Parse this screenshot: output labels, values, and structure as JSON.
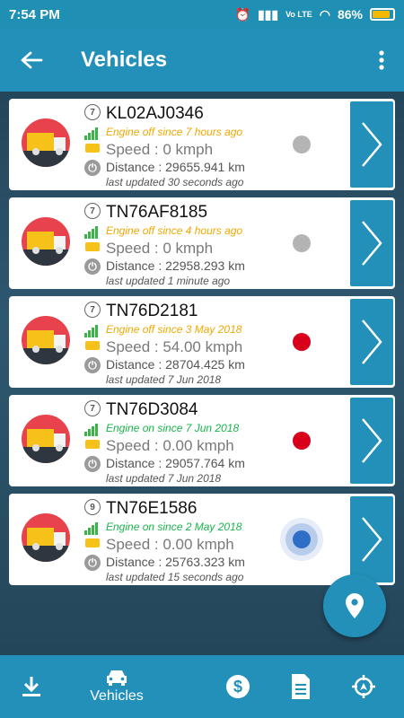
{
  "status_bar": {
    "time": "7:54 PM",
    "battery": "86%",
    "network": "Vo LTE"
  },
  "app_bar": {
    "title": "Vehicles"
  },
  "vehicles": [
    {
      "plate": "KL02AJ0346",
      "clock_badge": "7",
      "status": "Engine off since 7 hours ago",
      "speed": "Speed : 0 kmph",
      "distance": "Distance : 29655.941 km",
      "updated": "last updated 30 seconds ago"
    },
    {
      "plate": "TN76AF8185",
      "clock_badge": "7",
      "status": "Engine off since 4 hours ago",
      "speed": "Speed : 0 kmph",
      "distance": "Distance : 22958.293 km",
      "updated": "last updated 1 minute ago"
    },
    {
      "plate": "TN76D2181",
      "clock_badge": "7",
      "status": "Engine off since 3 May 2018",
      "speed": "Speed : 54.00 kmph",
      "distance": "Distance : 28704.425 km",
      "updated": "last updated 7 Jun 2018"
    },
    {
      "plate": "TN76D3084",
      "clock_badge": "7",
      "status": "Engine on since 7 Jun 2018",
      "speed": "Speed : 0.00 kmph",
      "distance": "Distance : 29057.764 km",
      "updated": "last updated 7 Jun 2018"
    },
    {
      "plate": "TN76E1586",
      "clock_badge": "9",
      "status": "Engine on since 2 May 2018",
      "speed": "Speed : 0.00 kmph",
      "distance": "Distance : 25763.323 km",
      "updated": "last updated 15 seconds ago"
    }
  ],
  "bottom_nav": {
    "vehicles_label": "Vehicles"
  },
  "colors": {
    "primary": "#2290b8",
    "engine_off": "#f0a800",
    "engine_on": "#18b54a",
    "dot_idle": "#b4b4b4",
    "dot_alert": "#d9001b",
    "dot_live": "#2f6ec7"
  }
}
